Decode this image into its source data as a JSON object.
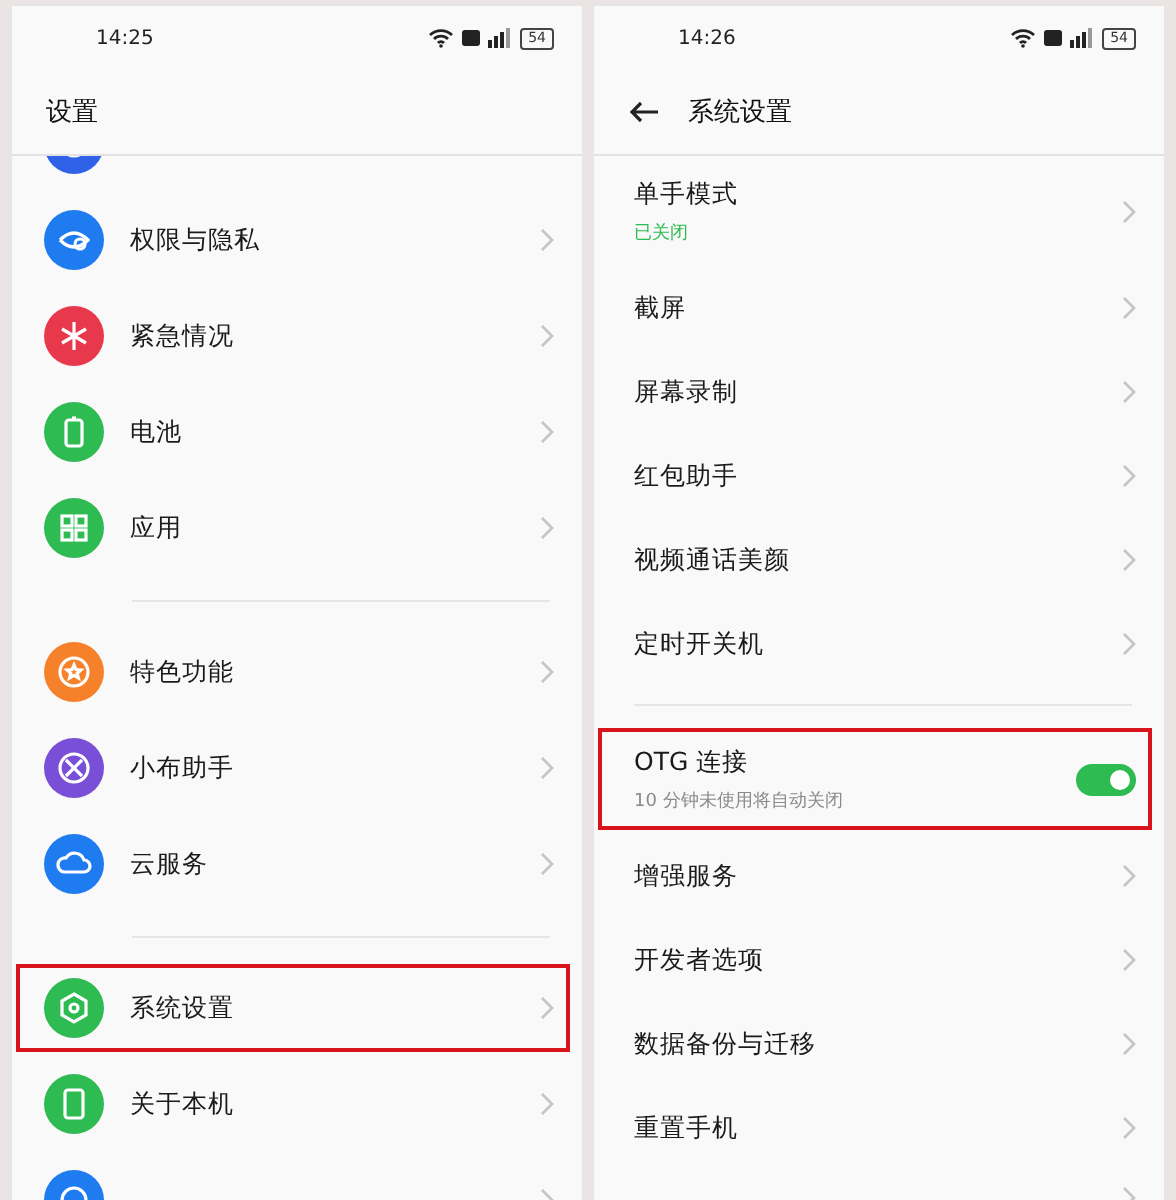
{
  "panels": [
    {
      "status_bar": {
        "time": "14:25",
        "battery": "54"
      },
      "header": {
        "title": "设置",
        "back": false
      },
      "groups": [
        [
          {
            "kind": "cut",
            "color": "#2f62e8",
            "highlighted": false
          },
          {
            "kind": "link",
            "label": "权限与隐私",
            "color": "#1f7cf0",
            "highlighted": false
          },
          {
            "kind": "link",
            "label": "紧急情况",
            "color": "#e8394c",
            "highlighted": false
          },
          {
            "kind": "link",
            "label": "电池",
            "color": "#2dbb52",
            "highlighted": false
          },
          {
            "kind": "link",
            "label": "应用",
            "color": "#2dbb52",
            "highlighted": false
          }
        ],
        [
          {
            "kind": "link",
            "label": "特色功能",
            "color": "#f5822a",
            "highlighted": false
          },
          {
            "kind": "link",
            "label": "小布助手",
            "color": "#7a4fd8",
            "highlighted": false
          },
          {
            "kind": "link",
            "label": "云服务",
            "color": "#1f7cf0",
            "highlighted": false
          }
        ],
        [
          {
            "kind": "link",
            "label": "系统设置",
            "color": "#2dbb52",
            "highlighted": true
          },
          {
            "kind": "link",
            "label": "关于本机",
            "color": "#2dbb52",
            "highlighted": false
          },
          {
            "kind": "cut",
            "color": "#1f7cf0",
            "highlighted": false
          }
        ]
      ]
    },
    {
      "status_bar": {
        "time": "14:26",
        "battery": "54"
      },
      "header": {
        "title": "系统设置",
        "back": true
      },
      "groups": [
        [
          {
            "kind": "link",
            "label": "单手模式",
            "sub": "已关闭",
            "highlighted": false
          },
          {
            "kind": "link",
            "label": "截屏",
            "highlighted": false
          },
          {
            "kind": "link",
            "label": "屏幕录制",
            "highlighted": false
          },
          {
            "kind": "link",
            "label": "红包助手",
            "highlighted": false
          },
          {
            "kind": "link",
            "label": "视频通话美颜",
            "highlighted": false
          },
          {
            "kind": "link",
            "label": "定时开关机",
            "highlighted": false
          }
        ],
        [
          {
            "kind": "toggle",
            "label": "OTG 连接",
            "sub": "10 分钟未使用将自动关闭",
            "on": true,
            "highlighted": true
          },
          {
            "kind": "link",
            "label": "增强服务",
            "highlighted": false
          },
          {
            "kind": "link",
            "label": "开发者选项",
            "highlighted": false
          },
          {
            "kind": "link",
            "label": "数据备份与迁移",
            "highlighted": false
          },
          {
            "kind": "link",
            "label": "重置手机",
            "highlighted": false
          },
          {
            "kind": "cut",
            "highlighted": false
          }
        ]
      ]
    }
  ]
}
